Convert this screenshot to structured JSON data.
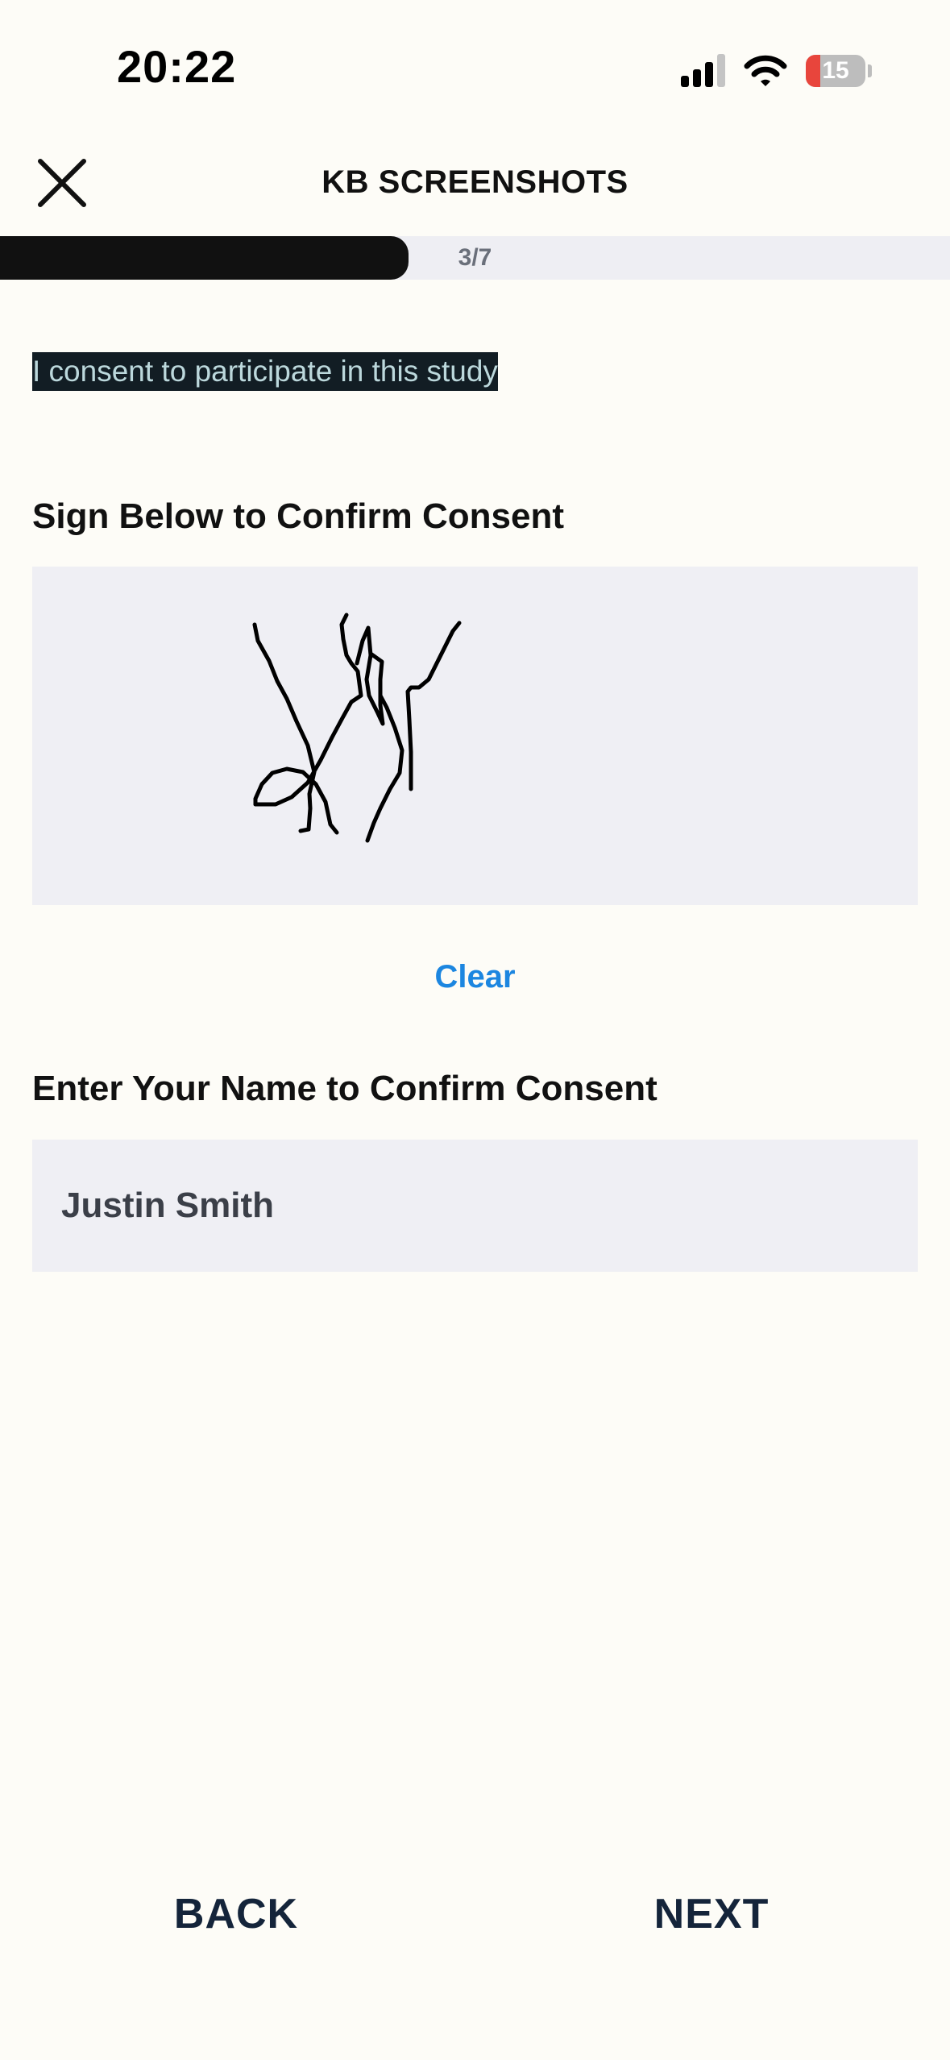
{
  "status_bar": {
    "time": "20:22",
    "battery_level": "15",
    "icons": [
      "cellular-signal-icon",
      "wifi-icon",
      "battery-icon"
    ]
  },
  "header": {
    "title": "KB SCREENSHOTS",
    "close_icon": "close-icon"
  },
  "progress": {
    "label": "3/7",
    "fraction": 0.43
  },
  "consent": {
    "statement": "I consent to participate in this study"
  },
  "signature": {
    "label": "Sign Below to Confirm Consent",
    "clear_label": "Clear"
  },
  "name": {
    "label": "Enter Your Name to Confirm Consent",
    "value": "Justin Smith"
  },
  "footer": {
    "back_label": "BACK",
    "next_label": "NEXT"
  },
  "colors": {
    "background": "#fdfcf7",
    "accent": "#1c86e0",
    "nav_text": "#14243a",
    "field_background": "#efeff4"
  }
}
